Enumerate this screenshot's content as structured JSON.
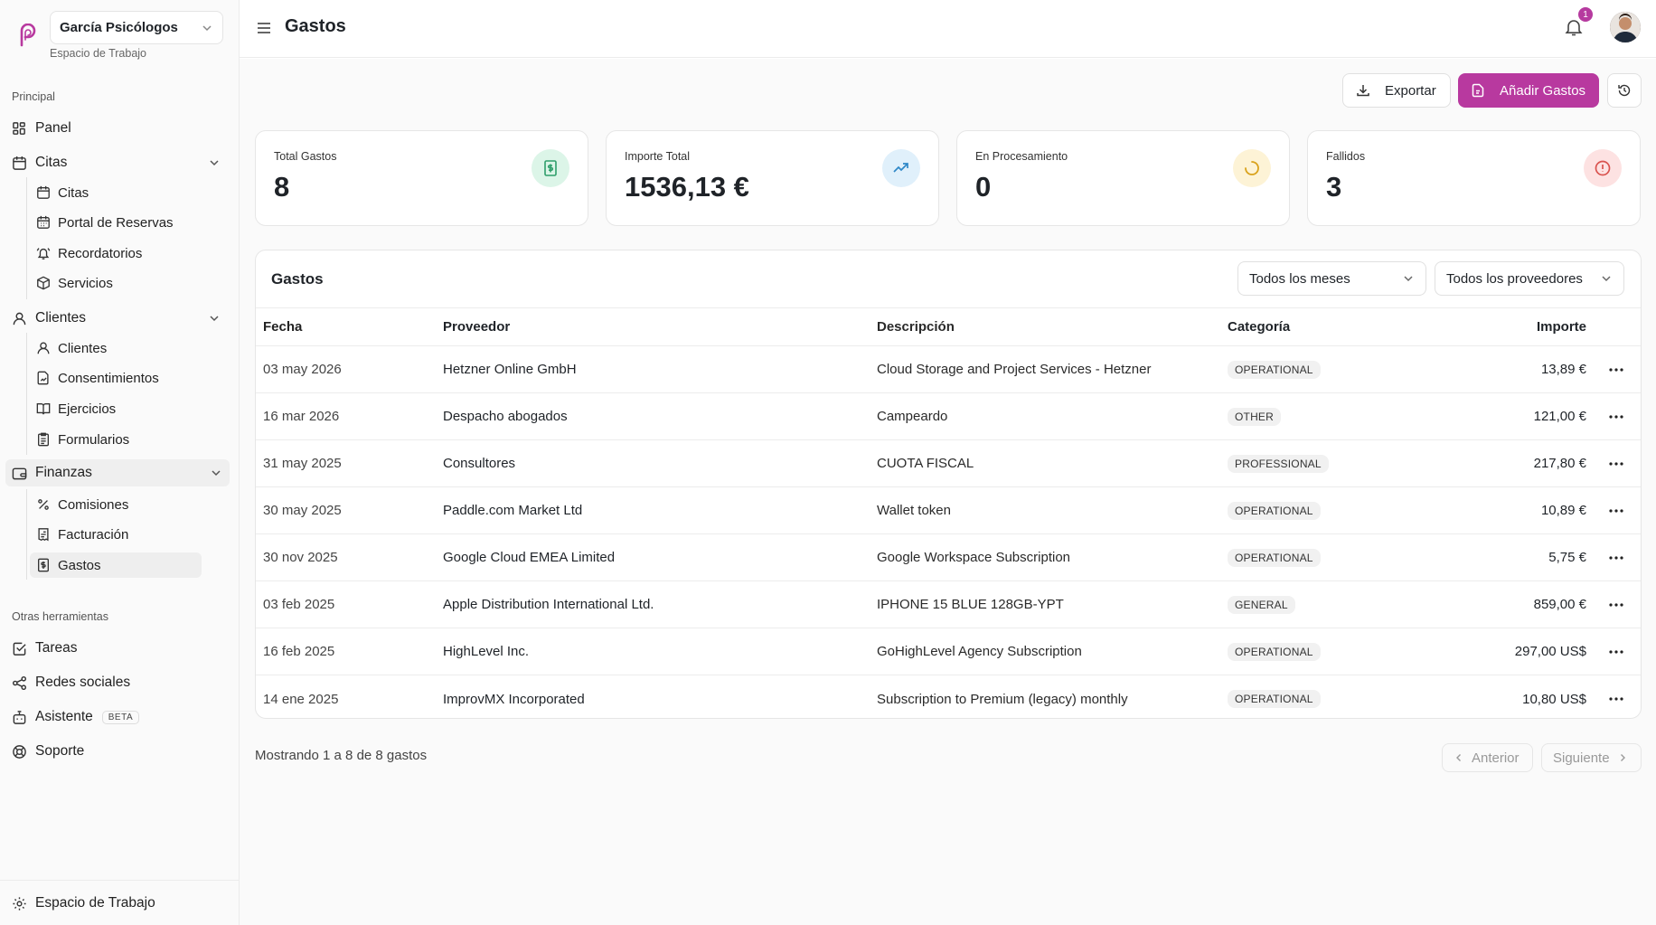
{
  "workspace": {
    "name": "García Psicólogos",
    "subtitle": "Espacio de Trabajo"
  },
  "sidebar": {
    "section_main": "Principal",
    "panel": "Panel",
    "citas_group": "Citas",
    "citas_items": [
      "Citas",
      "Portal de Reservas",
      "Recordatorios",
      "Servicios"
    ],
    "clientes_group": "Clientes",
    "clientes_items": [
      "Clientes",
      "Consentimientos",
      "Ejercicios",
      "Formularios"
    ],
    "finanzas_group": "Finanzas",
    "finanzas_items": [
      "Comisiones",
      "Facturación",
      "Gastos"
    ],
    "section_tools": "Otras herramientas",
    "tareas": "Tareas",
    "redes": "Redes sociales",
    "asistente": "Asistente",
    "beta": "BETA",
    "soporte": "Soporte",
    "footer": "Espacio de Trabajo"
  },
  "header": {
    "title": "Gastos",
    "notifications": "1"
  },
  "actions": {
    "export": "Exportar",
    "add": "Añadir Gastos"
  },
  "stats": [
    {
      "label": "Total Gastos",
      "value": "8",
      "color": "#2e9e6a",
      "bg": "#dcf5e8"
    },
    {
      "label": "Importe Total",
      "value": "1536,13 €",
      "color": "#2f88c8",
      "bg": "#e0f0fb"
    },
    {
      "label": "En Procesamiento",
      "value": "0",
      "color": "#d9a21b",
      "bg": "#fdf3d6"
    },
    {
      "label": "Fallidos",
      "value": "3",
      "color": "#d9534f",
      "bg": "#fde2e2"
    }
  ],
  "table": {
    "title": "Gastos",
    "filter_month": "Todos los meses",
    "filter_provider": "Todos los proveedores",
    "headers": {
      "date": "Fecha",
      "provider": "Proveedor",
      "description": "Descripción",
      "category": "Categoría",
      "amount": "Importe"
    },
    "rows": [
      {
        "date": "03 may 2026",
        "provider": "Hetzner Online GmbH",
        "description": "Cloud Storage and Project Services - Hetzner",
        "category": "OPERATIONAL",
        "amount": "13,89 €"
      },
      {
        "date": "16 mar 2026",
        "provider": "Despacho abogados",
        "description": "Campeardo",
        "category": "OTHER",
        "amount": "121,00 €"
      },
      {
        "date": "31 may 2025",
        "provider": "Consultores",
        "description": "CUOTA FISCAL",
        "category": "PROFESSIONAL",
        "amount": "217,80 €"
      },
      {
        "date": "30 may 2025",
        "provider": "Paddle.com Market Ltd",
        "description": "Wallet token",
        "category": "OPERATIONAL",
        "amount": "10,89 €"
      },
      {
        "date": "30 nov 2025",
        "provider": "Google Cloud EMEA Limited",
        "description": "Google Workspace Subscription",
        "category": "OPERATIONAL",
        "amount": "5,75 €"
      },
      {
        "date": "03 feb 2025",
        "provider": "Apple Distribution International Ltd.",
        "description": "IPHONE 15 BLUE 128GB-YPT",
        "category": "GENERAL",
        "amount": "859,00 €"
      },
      {
        "date": "16 feb 2025",
        "provider": "HighLevel Inc.",
        "description": "GoHighLevel Agency Subscription",
        "category": "OPERATIONAL",
        "amount": "297,00 US$"
      },
      {
        "date": "14 ene 2025",
        "provider": "ImprovMX Incorporated",
        "description": "Subscription to Premium (legacy) monthly",
        "category": "OPERATIONAL",
        "amount": "10,80 US$"
      }
    ]
  },
  "pagination": {
    "showing": "Mostrando 1 a 8 de 8 gastos",
    "prev": "Anterior",
    "next": "Siguiente"
  },
  "colors": {
    "accent": "#b8399f"
  }
}
